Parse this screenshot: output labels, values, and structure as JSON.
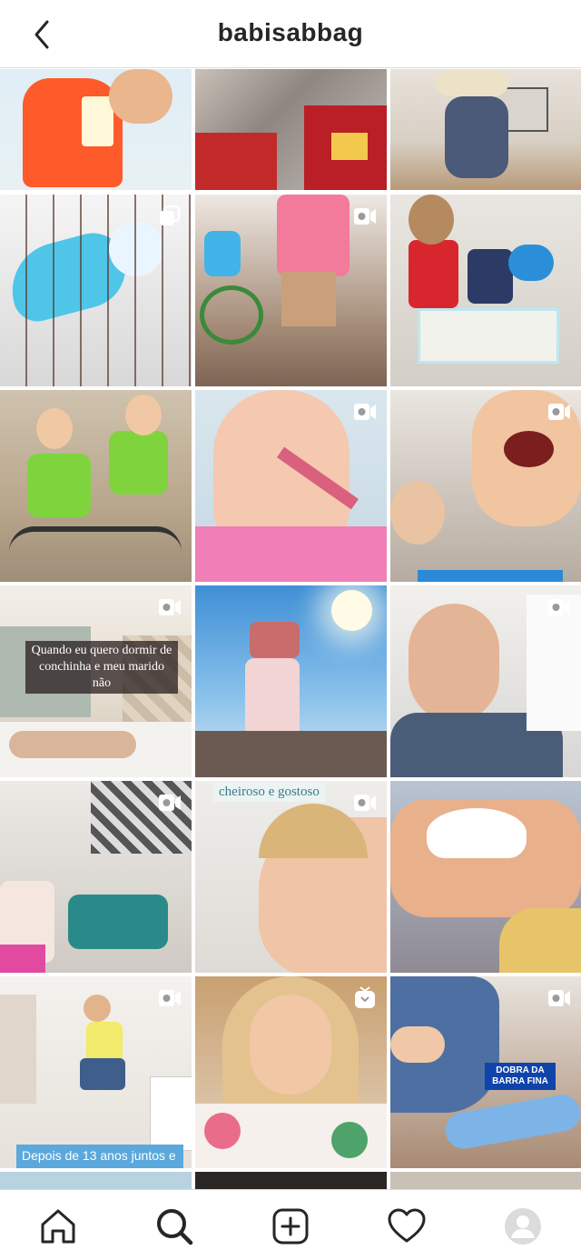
{
  "header": {
    "title": "babisabbag"
  },
  "grid": {
    "overlays": {
      "conchinha": "Quando eu quero dormir de conchinha e meu marido não",
      "cheiroso": "cheiroso e gostoso",
      "depois": "Depois de 13 anos juntos e",
      "dobra": "DOBRA DA BARRA FINA"
    },
    "badges": {
      "video": "video-icon",
      "carousel": "carousel-icon",
      "igtv": "igtv-icon"
    }
  },
  "tabbar": {
    "items": [
      "home-icon",
      "search-icon",
      "new-post-icon",
      "activity-heart-icon",
      "profile-avatar"
    ]
  },
  "colors": {
    "border": "#dbdbdb",
    "text": "#262626"
  }
}
